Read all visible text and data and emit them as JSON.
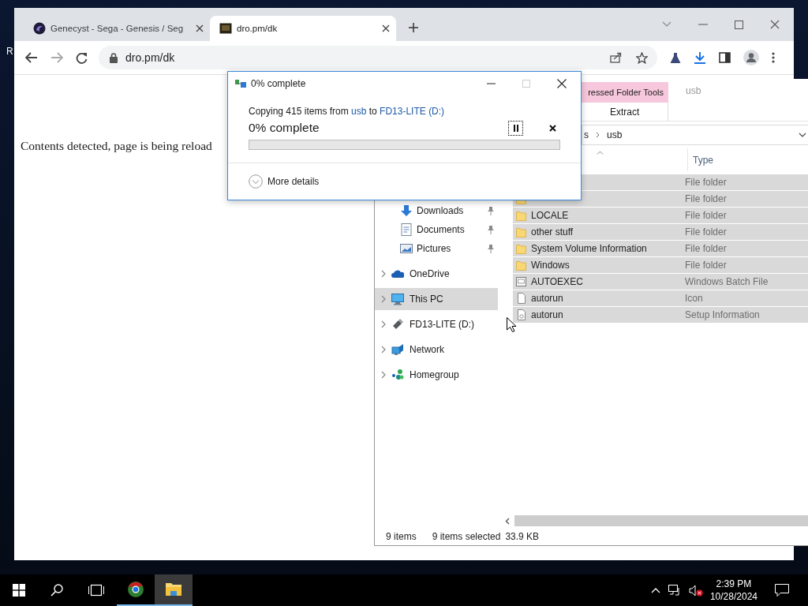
{
  "desktop": {
    "icon_label": "R"
  },
  "browser": {
    "tabs": [
      {
        "title": "Genecyst - Sega - Genesis / Seg",
        "selected": false
      },
      {
        "title": "dro.pm/dk",
        "selected": true
      }
    ],
    "address": "dro.pm/dk",
    "page_text": "Contents detected, page is being reload"
  },
  "explorer": {
    "title": "usb",
    "context_tab": "ressed Folder Tools",
    "ribbon_tab": "Extract",
    "breadcrumb": [
      "s",
      "usb"
    ],
    "type_column": "Type",
    "nav": [
      {
        "kind": "downloads",
        "label": "Downloads",
        "pinned": true,
        "selected": false
      },
      {
        "kind": "documents",
        "label": "Documents",
        "pinned": true,
        "selected": false
      },
      {
        "kind": "pictures",
        "label": "Pictures",
        "pinned": true,
        "selected": false
      },
      {
        "kind": "onedrive",
        "label": "OneDrive",
        "pinned": false,
        "selected": false
      },
      {
        "kind": "pc",
        "label": "This PC",
        "pinned": false,
        "selected": true
      },
      {
        "kind": "drive",
        "label": "FD13-LITE (D:)",
        "pinned": false,
        "selected": false
      },
      {
        "kind": "network",
        "label": "Network",
        "pinned": false,
        "selected": false
      },
      {
        "kind": "homegroup",
        "label": "Homegroup",
        "pinned": false,
        "selected": false
      }
    ],
    "rows": [
      {
        "type": "File folder",
        "selected": true
      },
      {
        "kind": "folder",
        "type": "File folder",
        "selected": true
      },
      {
        "kind": "folder",
        "name": "LOCALE",
        "type": "File folder",
        "selected": true
      },
      {
        "kind": "folder",
        "name": "other stuff",
        "type": "File folder",
        "selected": true
      },
      {
        "kind": "folder",
        "name": "System Volume Information",
        "type": "File folder",
        "selected": true
      },
      {
        "kind": "folder",
        "name": "Windows",
        "type": "File folder",
        "selected": true
      },
      {
        "kind": "batch",
        "name": "AUTOEXEC",
        "type": "Windows Batch File",
        "selected": true
      },
      {
        "kind": "file",
        "name": "autorun",
        "type": "Icon",
        "selected": true
      },
      {
        "kind": "setup",
        "name": "autorun",
        "type": "Setup Information",
        "selected": true
      }
    ],
    "status": [
      "9 items",
      "9 items selected",
      "33.9 KB"
    ]
  },
  "copy_dialog": {
    "title": "0% complete",
    "message": [
      {
        "kind": "text",
        "text": "Copying 415 items from "
      },
      {
        "kind": "link",
        "text": "usb"
      },
      {
        "kind": "text",
        "text": " to "
      },
      {
        "kind": "link",
        "text": "FD13-LITE (D:)"
      }
    ],
    "heading": "0% complete",
    "level": 0,
    "more_details": "More details"
  },
  "taskbar": {
    "apps": [
      {
        "kind": "browser",
        "open": true,
        "selected": false
      },
      {
        "kind": "explorer",
        "open": true,
        "selected": true
      }
    ],
    "time": "2:39 PM",
    "date": "10/28/2024"
  }
}
